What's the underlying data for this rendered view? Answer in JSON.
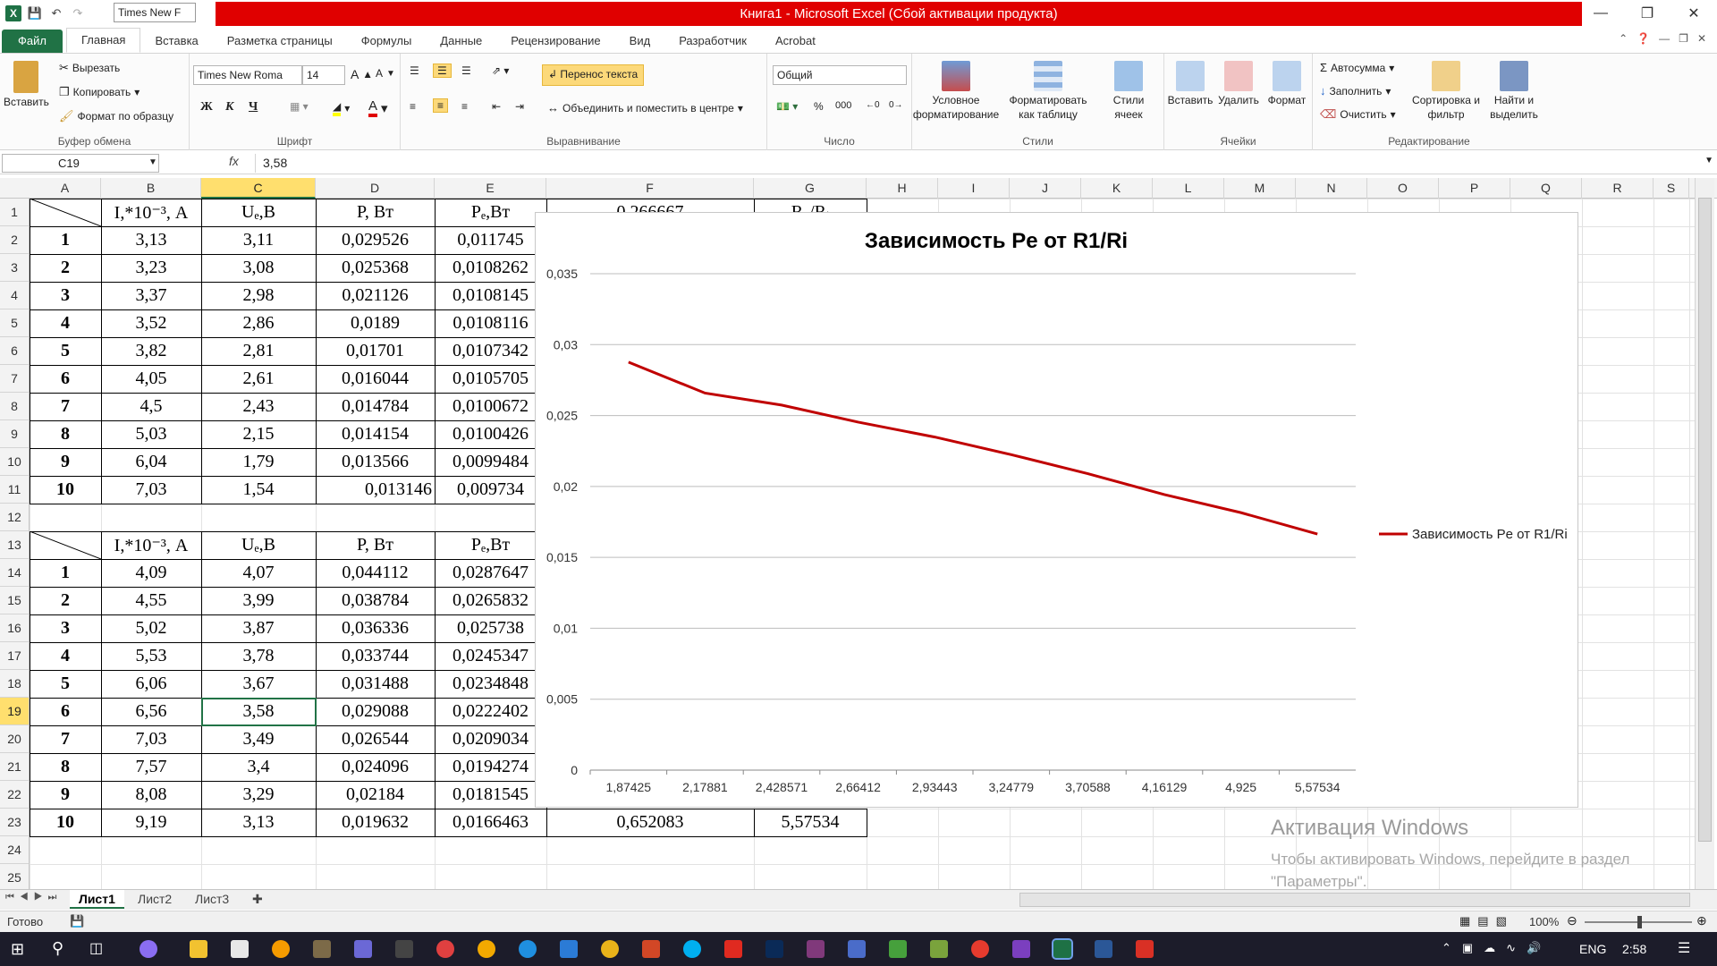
{
  "window": {
    "title": "Книга1 - Microsoft Excel (Сбой активации продукта)",
    "qat_font": "Times New F"
  },
  "tabs": [
    "Файл",
    "Главная",
    "Вставка",
    "Разметка страницы",
    "Формулы",
    "Данные",
    "Рецензирование",
    "Вид",
    "Разработчик",
    "Acrobat"
  ],
  "ribbon": {
    "clipboard": {
      "paste": "Вставить",
      "cut": "Вырезать",
      "copy": "Копировать",
      "format_painter": "Формат по образцу",
      "label": "Буфер обмена"
    },
    "font": {
      "name": "Times New Roma",
      "size": "14",
      "label": "Шрифт",
      "bold": "Ж",
      "italic": "К",
      "underline": "Ч"
    },
    "align": {
      "wrap": "Перенос текста",
      "merge": "Объединить и поместить в центре",
      "label": "Выравнивание"
    },
    "number": {
      "format": "Общий",
      "label": "Число"
    },
    "styles": {
      "cond": "Условное форматирование",
      "table": "Форматировать как таблицу",
      "cell": "Стили ячеек",
      "label": "Стили"
    },
    "cells": {
      "insert": "Вставить",
      "delete": "Удалить",
      "format": "Формат",
      "label": "Ячейки"
    },
    "edit": {
      "autosum": "Автосумма",
      "fill": "Заполнить",
      "clear": "Очистить",
      "sort": "Сортировка и фильтр",
      "find": "Найти и выделить",
      "label": "Редактирование"
    }
  },
  "formula_bar": {
    "cell_ref": "C19",
    "fx": "fx",
    "value": "3,58"
  },
  "columns": [
    "A",
    "B",
    "C",
    "D",
    "E",
    "F",
    "G",
    "H",
    "I",
    "J",
    "K",
    "L",
    "M",
    "N",
    "O",
    "P",
    "Q",
    "R",
    "S"
  ],
  "rows": [
    "1",
    "2",
    "3",
    "4",
    "5",
    "6",
    "7",
    "8",
    "9",
    "10",
    "11",
    "12",
    "13",
    "14",
    "15",
    "16",
    "17",
    "18",
    "19",
    "20",
    "21",
    "22",
    "23",
    "24",
    "25"
  ],
  "table1": {
    "header": [
      "",
      "I,*10⁻³, А",
      "Uₑ,В",
      "P, Вт",
      "Pₑ,Вт"
    ],
    "F1_partial": "0,266667",
    "G1_partial": "R₁/Rᵢ",
    "rows": [
      [
        "1",
        "3,13",
        "3,11",
        "0,029526",
        "0,011745"
      ],
      [
        "2",
        "3,23",
        "3,08",
        "0,025368",
        "0,0108262"
      ],
      [
        "3",
        "3,37",
        "2,98",
        "0,021126",
        "0,0108145"
      ],
      [
        "4",
        "3,52",
        "2,86",
        "0,0189",
        "0,0108116"
      ],
      [
        "5",
        "3,82",
        "2,81",
        "0,01701",
        "0,0107342"
      ],
      [
        "6",
        "4,05",
        "2,61",
        "0,016044",
        "0,0105705"
      ],
      [
        "7",
        "4,5",
        "2,43",
        "0,014784",
        "0,0100672"
      ],
      [
        "8",
        "5,03",
        "2,15",
        "0,014154",
        "0,0100426"
      ],
      [
        "9",
        "6,04",
        "1,79",
        "0,013566",
        "0,0099484"
      ],
      [
        "10",
        "7,03",
        "1,54",
        "0,013146",
        "0,009734"
      ]
    ]
  },
  "table2": {
    "header": [
      "",
      "I,*10⁻³, А",
      "Uₑ,В",
      "P, Вт",
      "Pₑ,Вт"
    ],
    "rows": [
      [
        "1",
        "4,09",
        "4,07",
        "0,044112",
        "0,0287647"
      ],
      [
        "2",
        "4,55",
        "3,99",
        "0,038784",
        "0,0265832"
      ],
      [
        "3",
        "5,02",
        "3,87",
        "0,036336",
        "0,025738"
      ],
      [
        "4",
        "5,53",
        "3,78",
        "0,033744",
        "0,0245347"
      ],
      [
        "5",
        "6,06",
        "3,67",
        "0,031488",
        "0,0234848"
      ],
      [
        "6",
        "6,56",
        "3,58",
        "0,029088",
        "0,0222402"
      ],
      [
        "7",
        "7,03",
        "3,49",
        "0,026544",
        "0,0209034"
      ],
      [
        "8",
        "7,57",
        "3,4",
        "0,024096",
        "0,0194274"
      ],
      [
        "9",
        "8,08",
        "3,29",
        "0,02184",
        "0,0181545"
      ],
      [
        "10",
        "9,19",
        "3,13",
        "0,019632",
        "0,0166463"
      ]
    ],
    "row23_F": "0,652083",
    "row23_G": "5,57534"
  },
  "chart_data": {
    "type": "line",
    "title": "Зависимость Pe от R1/Ri",
    "categories": [
      "1,87425",
      "2,17881",
      "2,428571",
      "2,66412",
      "2,93443",
      "3,24779",
      "3,70588",
      "4,16129",
      "4,925",
      "5,57534"
    ],
    "series": [
      {
        "name": "Зависимость Pe от R1/Ri",
        "values": [
          0.0287647,
          0.0265832,
          0.025738,
          0.0245347,
          0.0234848,
          0.0222402,
          0.0209034,
          0.0194274,
          0.0181545,
          0.0166463
        ],
        "color": "#c00000"
      }
    ],
    "yticks": [
      "0",
      "0,005",
      "0,01",
      "0,015",
      "0,02",
      "0,025",
      "0,03",
      "0,035"
    ],
    "ylim": [
      0,
      0.035
    ],
    "grid": true,
    "legend_position": "right"
  },
  "sheets": [
    "Лист1",
    "Лист2",
    "Лист3"
  ],
  "status": {
    "ready": "Готово",
    "zoom": "100%"
  },
  "watermark": {
    "title": "Активация Windows",
    "text": "Чтобы активировать Windows, перейдите в раздел \"Параметры\"."
  },
  "taskbar": {
    "lang": "ENG",
    "time": "2:58"
  }
}
